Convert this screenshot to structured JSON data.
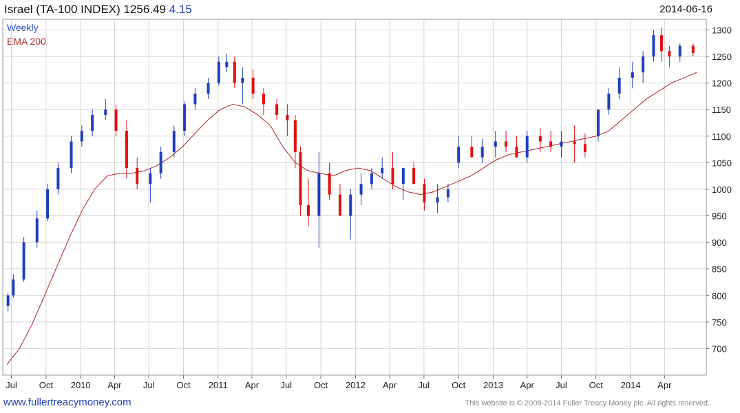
{
  "header": {
    "title": "Israel (TA-100 INDEX) 1256.49",
    "change": "4.15",
    "date": "2014-06-16"
  },
  "legend": {
    "series1": "Weekly",
    "series2": "EMA 200"
  },
  "footer": {
    "left": "www.fullertreacymoney.com",
    "right": "This website is © 2008-2014 Fuller Treacy Money plc. All rights reserved."
  },
  "colors": {
    "up": "#1f3fbf",
    "down": "#e01010",
    "ema": "#b02020",
    "grid": "#d4d4d4"
  },
  "chart_data": {
    "type": "candlestick",
    "xlabel": "",
    "ylabel": "",
    "ylim": [
      650,
      1320
    ],
    "yticks": [
      700,
      750,
      800,
      850,
      900,
      950,
      1000,
      1050,
      1100,
      1150,
      1200,
      1250,
      1300
    ],
    "xtick_labels": [
      "Jul",
      "Oct",
      "2010",
      "Apr",
      "Jul",
      "Oct",
      "2011",
      "Apr",
      "Jul",
      "Oct",
      "2012",
      "Apr",
      "Jul",
      "Oct",
      "2013",
      "Apr",
      "Jul",
      "Oct",
      "2014",
      "Apr"
    ],
    "grid": true,
    "x": [
      "2009-06-22",
      "2009-07-06",
      "2009-08-03",
      "2009-09-07",
      "2009-10-05",
      "2009-11-02",
      "2009-12-07",
      "2010-01-04",
      "2010-02-01",
      "2010-03-08",
      "2010-04-05",
      "2010-05-03",
      "2010-05-31",
      "2010-07-05",
      "2010-08-02",
      "2010-09-06",
      "2010-10-04",
      "2010-11-01",
      "2010-12-06",
      "2011-01-03",
      "2011-01-24",
      "2011-02-14",
      "2011-03-07",
      "2011-04-04",
      "2011-05-02",
      "2011-06-06",
      "2011-07-04",
      "2011-07-25",
      "2011-08-08",
      "2011-08-29",
      "2011-09-26",
      "2011-10-24",
      "2011-11-21",
      "2011-12-19",
      "2012-01-16",
      "2012-02-13",
      "2012-03-12",
      "2012-04-09",
      "2012-05-07",
      "2012-06-04",
      "2012-07-02",
      "2012-08-06",
      "2012-09-03",
      "2012-10-01",
      "2012-11-05",
      "2012-12-03",
      "2013-01-07",
      "2013-02-04",
      "2013-03-04",
      "2013-04-01",
      "2013-05-06",
      "2013-06-03",
      "2013-07-01",
      "2013-08-05",
      "2013-09-02",
      "2013-10-07",
      "2013-11-04",
      "2013-12-02",
      "2014-01-06",
      "2014-02-03",
      "2014-03-03",
      "2014-03-24",
      "2014-04-14",
      "2014-05-12",
      "2014-06-16"
    ],
    "series": [
      {
        "name": "Weekly",
        "open": [
          780,
          800,
          830,
          900,
          945,
          1000,
          1040,
          1090,
          1110,
          1140,
          1150,
          1110,
          1040,
          1010,
          1030,
          1070,
          1110,
          1160,
          1180,
          1200,
          1230,
          1240,
          1200,
          1210,
          1180,
          1160,
          1140,
          1130,
          1070,
          970,
          950,
          1030,
          990,
          950,
          990,
          1010,
          1030,
          1040,
          1010,
          1040,
          1010,
          975,
          985,
          1050,
          1080,
          1060,
          1080,
          1090,
          1080,
          1060,
          1100,
          1090,
          1080,
          1090,
          1085,
          1100,
          1150,
          1180,
          1210,
          1220,
          1250,
          1290,
          1260,
          1250,
          1270
        ],
        "high": [
          805,
          840,
          910,
          960,
          1010,
          1050,
          1100,
          1120,
          1150,
          1170,
          1160,
          1130,
          1060,
          1040,
          1080,
          1120,
          1165,
          1190,
          1210,
          1250,
          1255,
          1250,
          1230,
          1225,
          1190,
          1170,
          1160,
          1140,
          1080,
          1020,
          1070,
          1050,
          1010,
          1000,
          1030,
          1040,
          1060,
          1070,
          1040,
          1050,
          1020,
          1010,
          1010,
          1100,
          1100,
          1095,
          1110,
          1110,
          1100,
          1110,
          1115,
          1110,
          1110,
          1120,
          1105,
          1150,
          1190,
          1230,
          1240,
          1260,
          1300,
          1305,
          1270,
          1275,
          1275
        ],
        "low": [
          770,
          795,
          825,
          890,
          940,
          990,
          1030,
          1080,
          1100,
          1130,
          1100,
          1020,
          1000,
          975,
          1020,
          1060,
          1100,
          1150,
          1170,
          1195,
          1220,
          1190,
          1160,
          1170,
          1140,
          1130,
          1100,
          1040,
          950,
          930,
          890,
          980,
          950,
          905,
          970,
          1000,
          1020,
          1000,
          980,
          1010,
          960,
          955,
          975,
          1040,
          1060,
          1050,
          1060,
          1070,
          1060,
          1050,
          1070,
          1070,
          1060,
          1050,
          1060,
          1090,
          1140,
          1170,
          1190,
          1200,
          1240,
          1240,
          1230,
          1240,
          1250
        ],
        "close": [
          800,
          830,
          900,
          945,
          1000,
          1040,
          1090,
          1110,
          1140,
          1150,
          1110,
          1040,
          1010,
          1030,
          1070,
          1110,
          1160,
          1180,
          1200,
          1240,
          1240,
          1200,
          1210,
          1180,
          1160,
          1140,
          1130,
          1070,
          970,
          950,
          1030,
          990,
          950,
          990,
          1010,
          1030,
          1040,
          1010,
          1040,
          1010,
          975,
          985,
          1000,
          1080,
          1060,
          1080,
          1090,
          1080,
          1060,
          1100,
          1090,
          1080,
          1090,
          1085,
          1070,
          1150,
          1180,
          1210,
          1220,
          1250,
          1290,
          1260,
          1250,
          1270,
          1256.49
        ]
      },
      {
        "name": "EMA 200",
        "values": [
          670,
          700,
          745,
          800,
          855,
          910,
          960,
          1000,
          1025,
          1030,
          1030,
          1035,
          1045,
          1060,
          1080,
          1105,
          1130,
          1150,
          1160,
          1155,
          1140,
          1120,
          1080,
          1050,
          1035,
          1030,
          1025,
          1035,
          1040,
          1035,
          1020,
          1005,
          995,
          990,
          995,
          1005,
          1015,
          1025,
          1040,
          1055,
          1065,
          1070,
          1075,
          1080,
          1085,
          1090,
          1095,
          1100,
          1110,
          1130,
          1150,
          1170,
          1185,
          1200,
          1210,
          1220
        ]
      }
    ]
  }
}
